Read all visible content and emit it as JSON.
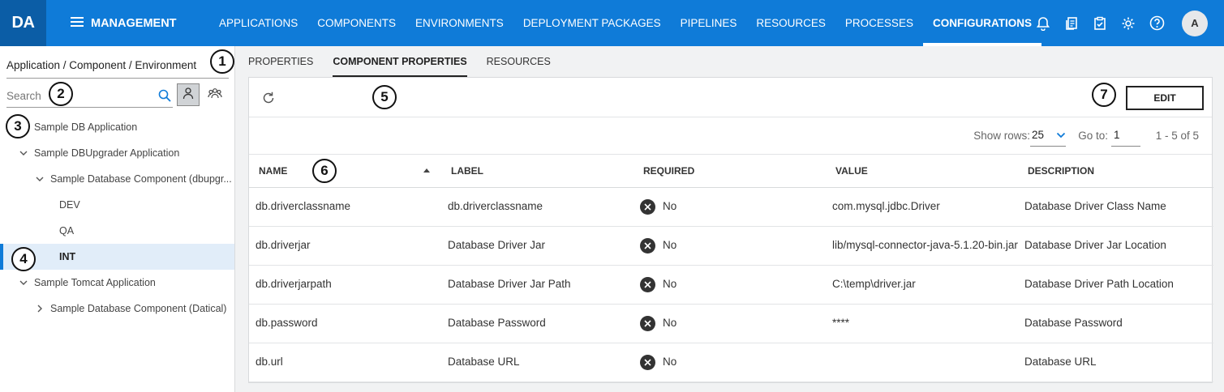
{
  "app": {
    "logo": "DA",
    "section": "MANAGEMENT"
  },
  "nav": {
    "items": [
      "APPLICATIONS",
      "COMPONENTS",
      "ENVIRONMENTS",
      "DEPLOYMENT PACKAGES",
      "PIPELINES",
      "RESOURCES",
      "PROCESSES",
      "CONFIGURATIONS"
    ],
    "active": "CONFIGURATIONS"
  },
  "top_icons": [
    "bell-icon",
    "documents-icon",
    "clipboard-check-icon",
    "gear-icon",
    "help-icon"
  ],
  "user": {
    "avatar_initial": "A"
  },
  "sidebar": {
    "title": "Application / Component / Environment",
    "search_placeholder": "Search",
    "tree": [
      {
        "label": "Sample DB Application",
        "level": 0,
        "expander": "none"
      },
      {
        "label": "Sample DBUpgrader Application",
        "level": 0,
        "expander": "expanded"
      },
      {
        "label": "Sample Database Component (dbupgr...",
        "level": 1,
        "expander": "expanded"
      },
      {
        "label": "DEV",
        "level": 2,
        "expander": "none"
      },
      {
        "label": "QA",
        "level": 2,
        "expander": "none"
      },
      {
        "label": "INT",
        "level": 2,
        "expander": "none",
        "selected": true
      },
      {
        "label": "Sample Tomcat Application",
        "level": 0,
        "expander": "expanded"
      },
      {
        "label": "Sample Database Component (Datical)",
        "level": 1,
        "expander": "collapsed"
      }
    ]
  },
  "tabs": {
    "items": [
      "PROPERTIES",
      "COMPONENT PROPERTIES",
      "RESOURCES"
    ],
    "active": "COMPONENT PROPERTIES"
  },
  "toolbar": {
    "edit_label": "EDIT"
  },
  "pager": {
    "show_rows_label": "Show rows:",
    "rows": "25",
    "goto_label": "Go to:",
    "goto_value": "1",
    "range": "1 - 5 of 5"
  },
  "table": {
    "columns": [
      "NAME",
      "LABEL",
      "REQUIRED",
      "VALUE",
      "DESCRIPTION"
    ],
    "rows": [
      {
        "name": "db.driverclassname",
        "label": "db.driverclassname",
        "required": "No",
        "value": "com.mysql.jdbc.Driver",
        "description": "Database Driver Class Name"
      },
      {
        "name": "db.driverjar",
        "label": "Database Driver Jar",
        "required": "No",
        "value": "lib/mysql-connector-java-5.1.20-bin.jar",
        "description": "Database Driver Jar Location"
      },
      {
        "name": "db.driverjarpath",
        "label": "Database Driver Jar Path",
        "required": "No",
        "value": "C:\\temp\\driver.jar",
        "description": "Database Driver Path Location"
      },
      {
        "name": "db.password",
        "label": "Database Password",
        "required": "No",
        "value": "****",
        "description": "Database Password"
      },
      {
        "name": "db.url",
        "label": "Database URL",
        "required": "No",
        "value": "",
        "description": "Database URL"
      }
    ]
  },
  "callouts": [
    "1",
    "2",
    "3",
    "4",
    "5",
    "6",
    "7"
  ],
  "colors": {
    "topbar": "#0f7bd8",
    "logo_bg": "#0b5da6",
    "selected_row": "#e1edf9"
  }
}
